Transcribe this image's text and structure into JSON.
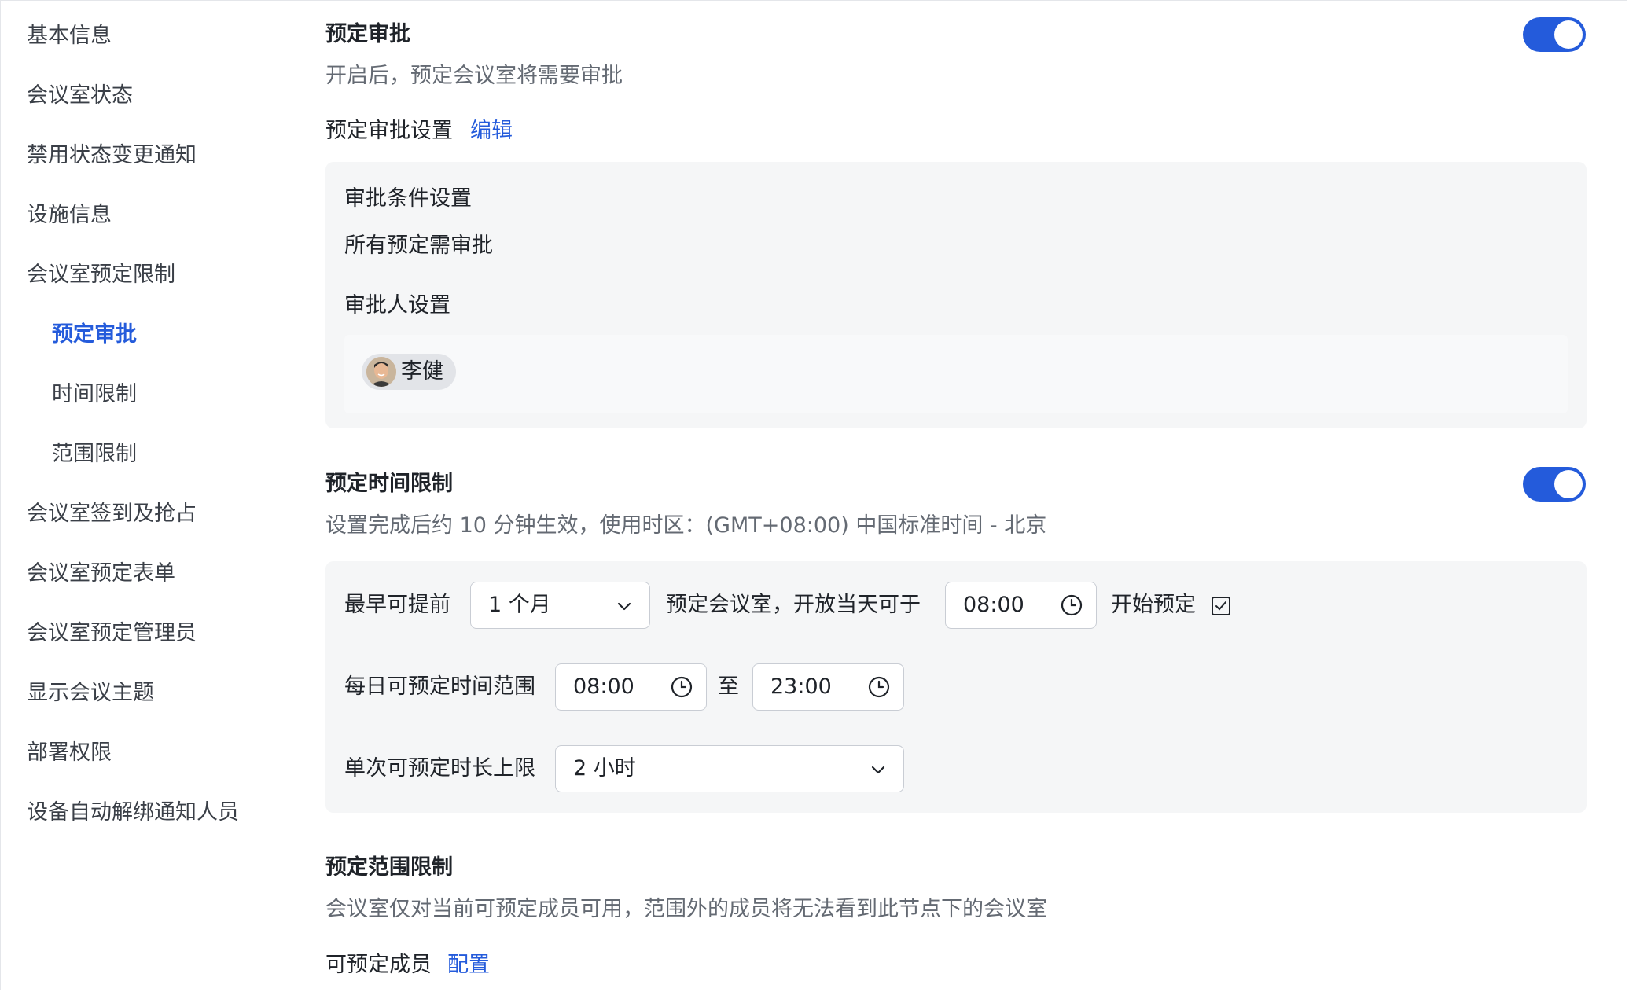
{
  "sidebar": {
    "items": [
      {
        "label": "基本信息"
      },
      {
        "label": "会议室状态"
      },
      {
        "label": "禁用状态变更通知"
      },
      {
        "label": "设施信息"
      },
      {
        "label": "会议室预定限制"
      },
      {
        "label": "预定审批"
      },
      {
        "label": "时间限制"
      },
      {
        "label": "范围限制"
      },
      {
        "label": "会议室签到及抢占"
      },
      {
        "label": "会议室预定表单"
      },
      {
        "label": "会议室预定管理员"
      },
      {
        "label": "显示会议主题"
      },
      {
        "label": "部署权限"
      },
      {
        "label": "设备自动解绑通知人员"
      }
    ],
    "active_item": "预定审批"
  },
  "approval": {
    "title": "预定审批",
    "enabled": true,
    "description": "开启后，预定会议室将需要审批",
    "settings_label": "预定审批设置",
    "edit_link": "编辑",
    "condition_heading": "审批条件设置",
    "condition_value": "所有预定需审批",
    "approver_heading": "审批人设置",
    "approver_name": "李健"
  },
  "time_limit": {
    "title": "预定时间限制",
    "enabled": true,
    "description": "设置完成后约 10 分钟生效，使用时区：(GMT+08:00) 中国标准时间 - 北京",
    "advance_label": "最早可提前",
    "advance_value": "1 个月",
    "advance_suffix": "预定会议室，开放当天可于",
    "open_time": "08:00",
    "open_suffix": "开始预定",
    "daily_label": "每日可预定时间范围",
    "daily_start": "08:00",
    "daily_to": "至",
    "daily_end": "23:00",
    "max_label": "单次可预定时长上限",
    "max_value": "2 小时"
  },
  "scope_limit": {
    "title": "预定范围限制",
    "description": "会议室仅对当前可预定成员可用，范围外的成员将无法看到此节点下的会议室",
    "members_label": "可预定成员",
    "config_link": "配置"
  },
  "colors": {
    "accent": "#245bdb",
    "panel_bg": "#f5f6f7",
    "text_primary": "#1f2329",
    "text_secondary": "#646a73"
  }
}
